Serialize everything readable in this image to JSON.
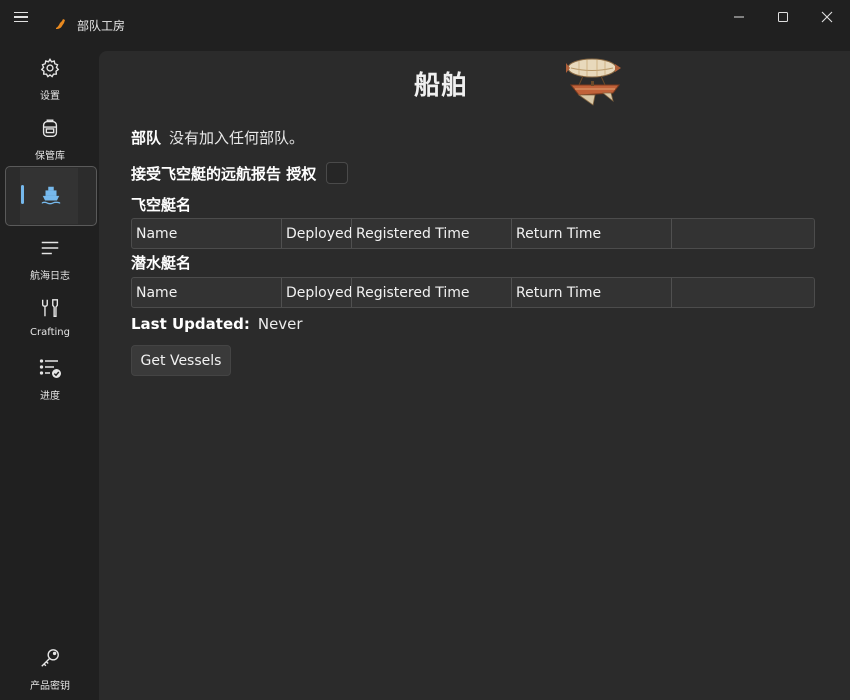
{
  "window": {
    "title": "部队工房",
    "icons": {
      "menu": "hamburger-icon",
      "app": "app-icon",
      "minimize": "minimize-icon",
      "maximize": "maximize-icon",
      "close": "close-icon"
    }
  },
  "sidebar": {
    "items": [
      {
        "label": "设置",
        "icon": "gear-icon"
      },
      {
        "label": "保管库",
        "icon": "backpack-icon"
      },
      {
        "label": "",
        "icon": "ship-icon",
        "active": true
      },
      {
        "label": "航海日志",
        "icon": "list-icon"
      },
      {
        "label": "Crafting",
        "icon": "wrench-icon"
      },
      {
        "label": "进度",
        "icon": "checklist-icon"
      },
      {
        "label": "产品密钥",
        "icon": "key-icon"
      }
    ]
  },
  "main": {
    "title": "船舶",
    "fc_label": "部队",
    "fc_value": "没有加入任何部队。",
    "auth_label": "接受飞空艇的远航报告 授权",
    "auth_checked": false,
    "airship_section": "飞空艇名",
    "submarine_section": "潜水艇名",
    "columns": [
      "Name",
      "Deployed",
      "Registered Time",
      "Return Time",
      ""
    ],
    "last_updated_label": "Last Updated:",
    "last_updated_value": "Never",
    "get_button": "Get Vessels"
  },
  "colors": {
    "accent": "#76b9ed",
    "background": "#202020",
    "content": "#2b2b2b"
  }
}
